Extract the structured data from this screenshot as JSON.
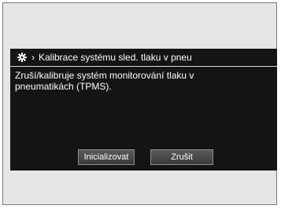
{
  "header": {
    "title": "Kalibrace systému sled. tlaku v pneu",
    "icon": "settings-gear-icon",
    "chevron": "›"
  },
  "body": {
    "description": "Zruší/kalibruje systém monitorování tlaku v\npneumatikách (TPMS)."
  },
  "buttons": {
    "initialize_label": "Inicializovat",
    "cancel_label": "Zrušit"
  },
  "colors": {
    "background": "#141414",
    "text": "#ffffff",
    "frame": "#e6e6e6"
  }
}
